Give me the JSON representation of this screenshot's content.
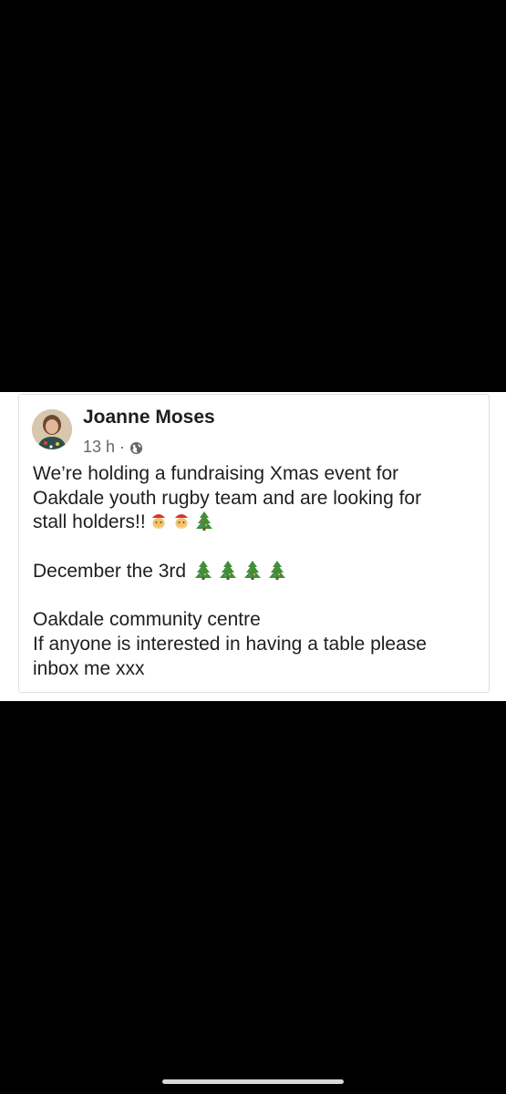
{
  "post": {
    "author": "Joanne Moses",
    "time": "13 h",
    "separator": "·",
    "privacy_icon": "globe-icon",
    "line1": "We’re holding a fundraising Xmas event for",
    "line2": "Oakdale youth rugby team and are looking for",
    "line3": "stall holders!!",
    "line3_emoji": [
      "santa-face-icon",
      "santa-face-icon",
      "christmas-tree-icon"
    ],
    "line4": "December the 3rd",
    "line4_emoji": [
      "christmas-tree-icon",
      "christmas-tree-icon",
      "christmas-tree-icon",
      "christmas-tree-icon"
    ],
    "line5": "Oakdale community centre",
    "line6": "If anyone is interested in having a table please",
    "line7": "inbox me xxx"
  },
  "colors": {
    "background": "#000000",
    "card": "#ffffff",
    "text": "#1c1e21",
    "meta": "#65676b"
  }
}
